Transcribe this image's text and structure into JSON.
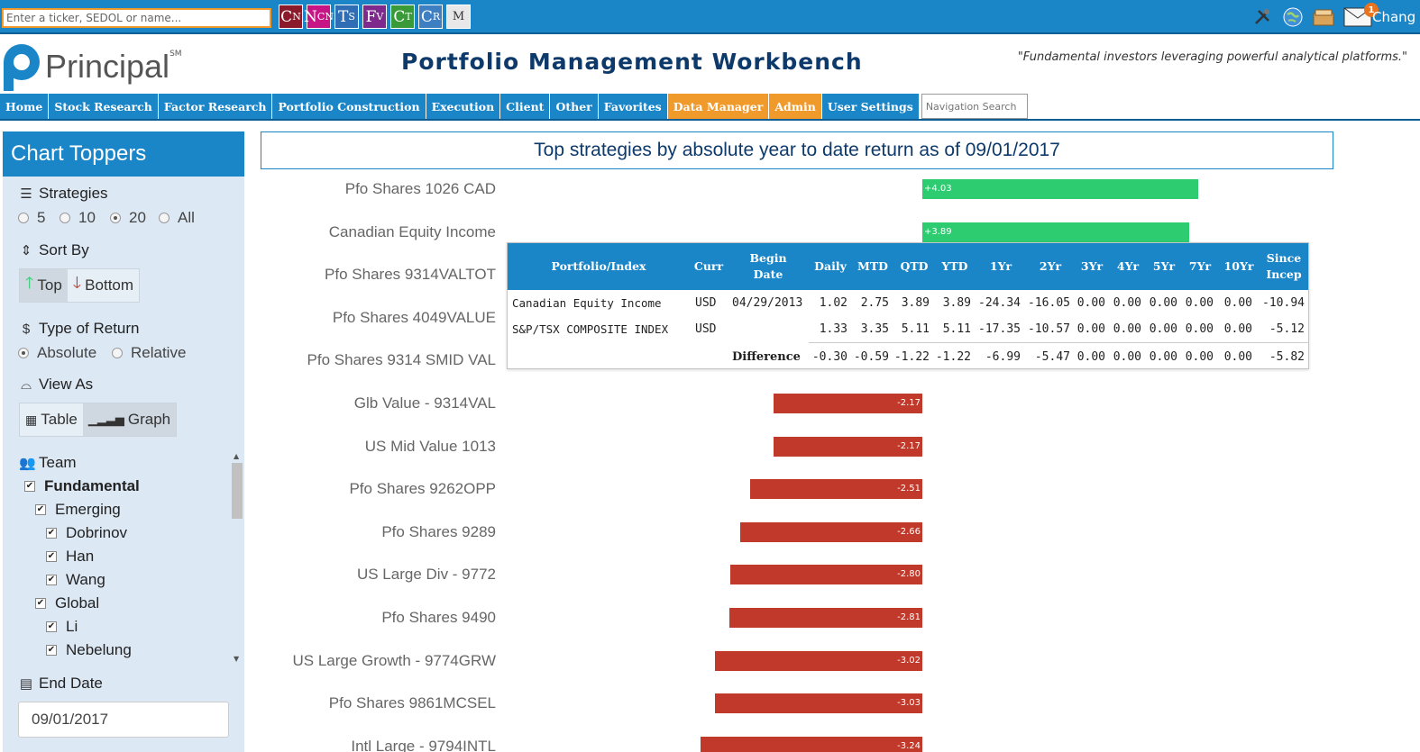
{
  "topbar": {
    "ticker_placeholder": "Enter a ticker, SEDOL or name...",
    "apps": [
      {
        "main": "C",
        "sub": "N",
        "color": "#8b1a2b"
      },
      {
        "main": "N",
        "sub": "CN",
        "color": "#c71585"
      },
      {
        "main": "T",
        "sub": "S",
        "color": "#2f6db5"
      },
      {
        "main": "F",
        "sub": "V",
        "color": "#7d2a8c"
      },
      {
        "main": "C",
        "sub": "T",
        "color": "#3a9a3a"
      },
      {
        "main": "C",
        "sub": "R",
        "color": "#3d7fc1"
      },
      {
        "main": "M",
        "sub": "",
        "color": "#e8e8e8"
      }
    ],
    "mail_count": "1",
    "user_name": "Chang"
  },
  "header": {
    "logo_text": "Principal",
    "logo_sm": "SM",
    "title": "Portfolio Management Workbench",
    "tagline": "\"Fundamental investors leveraging powerful analytical platforms.\""
  },
  "nav": {
    "items": [
      {
        "label": "Home",
        "accent": false
      },
      {
        "label": "Stock Research",
        "accent": false
      },
      {
        "label": "Factor Research",
        "accent": false
      },
      {
        "label": "Portfolio Construction",
        "accent": false
      },
      {
        "label": "Execution",
        "accent": false
      },
      {
        "label": "Client",
        "accent": false
      },
      {
        "label": "Other",
        "accent": false
      },
      {
        "label": "Favorites",
        "accent": false
      },
      {
        "label": "Data Manager",
        "accent": true
      },
      {
        "label": "Admin",
        "accent": true
      },
      {
        "label": "User Settings",
        "accent": false
      }
    ],
    "search_placeholder": "Navigation Search"
  },
  "sidebar": {
    "title": "Chart Toppers",
    "strategies_label": "Strategies",
    "strategies_options": [
      "5",
      "10",
      "20",
      "All"
    ],
    "strategies_selected": "20",
    "sort_label": "Sort By",
    "sort_top": "Top",
    "sort_bottom": "Bottom",
    "return_label": "Type of Return",
    "return_options": [
      "Absolute",
      "Relative"
    ],
    "return_selected": "Absolute",
    "view_label": "View As",
    "view_table": "Table",
    "view_graph": "Graph",
    "team_label": "Team",
    "team_tree": [
      {
        "label": "Fundamental",
        "level": 0,
        "bold": true
      },
      {
        "label": "Emerging",
        "level": 1,
        "bold": false
      },
      {
        "label": "Dobrinov",
        "level": 2,
        "bold": false
      },
      {
        "label": "Han",
        "level": 2,
        "bold": false
      },
      {
        "label": "Wang",
        "level": 2,
        "bold": false
      },
      {
        "label": "Global",
        "level": 1,
        "bold": false
      },
      {
        "label": "Li",
        "level": 2,
        "bold": false
      },
      {
        "label": "Nebelung",
        "level": 2,
        "bold": false
      }
    ],
    "end_date_label": "End Date",
    "end_date_value": "09/01/2017"
  },
  "chart_data": {
    "type": "bar",
    "title": "Top strategies by absolute year to date return as of 09/01/2017",
    "orientation": "horizontal",
    "categories": [
      "Pfo Shares 1026 CAD",
      "Canadian Equity Income",
      "Pfo Shares 9314VALTOT",
      "Pfo Shares 4049VALUE",
      "Pfo Shares 9314 SMID VAL",
      "Glb Value - 9314VAL",
      "US Mid Value 1013",
      "Pfo Shares 9262OPP",
      "Pfo Shares 9289",
      "US Large Div - 9772",
      "Pfo Shares 9490",
      "US Large Growth - 9774GRW",
      "Pfo Shares 9861MCSEL",
      "Intl Large - 9794INTL"
    ],
    "values": [
      4.03,
      3.89,
      null,
      null,
      null,
      -2.17,
      -2.17,
      -2.51,
      -2.66,
      -2.8,
      -2.81,
      -3.02,
      -3.03,
      -3.24
    ],
    "value_labels": [
      "+4.03",
      "+3.89",
      "",
      "",
      "",
      "-2.17",
      "-2.17",
      "-2.51",
      "-2.66",
      "-2.80",
      "-2.81",
      "-3.02",
      "-3.03",
      "-3.24"
    ],
    "positive_color": "#2ecc71",
    "negative_color": "#c0392b"
  },
  "tooltip": {
    "headers": [
      "Portfolio/Index",
      "Curr",
      "Begin Date",
      "Daily",
      "MTD",
      "QTD",
      "YTD",
      "1Yr",
      "2Yr",
      "3Yr",
      "4Yr",
      "5Yr",
      "7Yr",
      "10Yr",
      "Since Incep"
    ],
    "rows": [
      [
        "Canadian Equity Income",
        "USD",
        "04/29/2013",
        "1.02",
        "2.75",
        "3.89",
        "3.89",
        "-24.34",
        "-16.05",
        "0.00",
        "0.00",
        "0.00",
        "0.00",
        "0.00",
        "-10.94"
      ],
      [
        "S&P/TSX COMPOSITE INDEX",
        "USD",
        "",
        "1.33",
        "3.35",
        "5.11",
        "5.11",
        "-17.35",
        "-10.57",
        "0.00",
        "0.00",
        "0.00",
        "0.00",
        "0.00",
        "-5.12"
      ],
      [
        "",
        "",
        "Difference",
        "-0.30",
        "-0.59",
        "-1.22",
        "-1.22",
        "-6.99",
        "-5.47",
        "0.00",
        "0.00",
        "0.00",
        "0.00",
        "0.00",
        "-5.82"
      ]
    ]
  }
}
